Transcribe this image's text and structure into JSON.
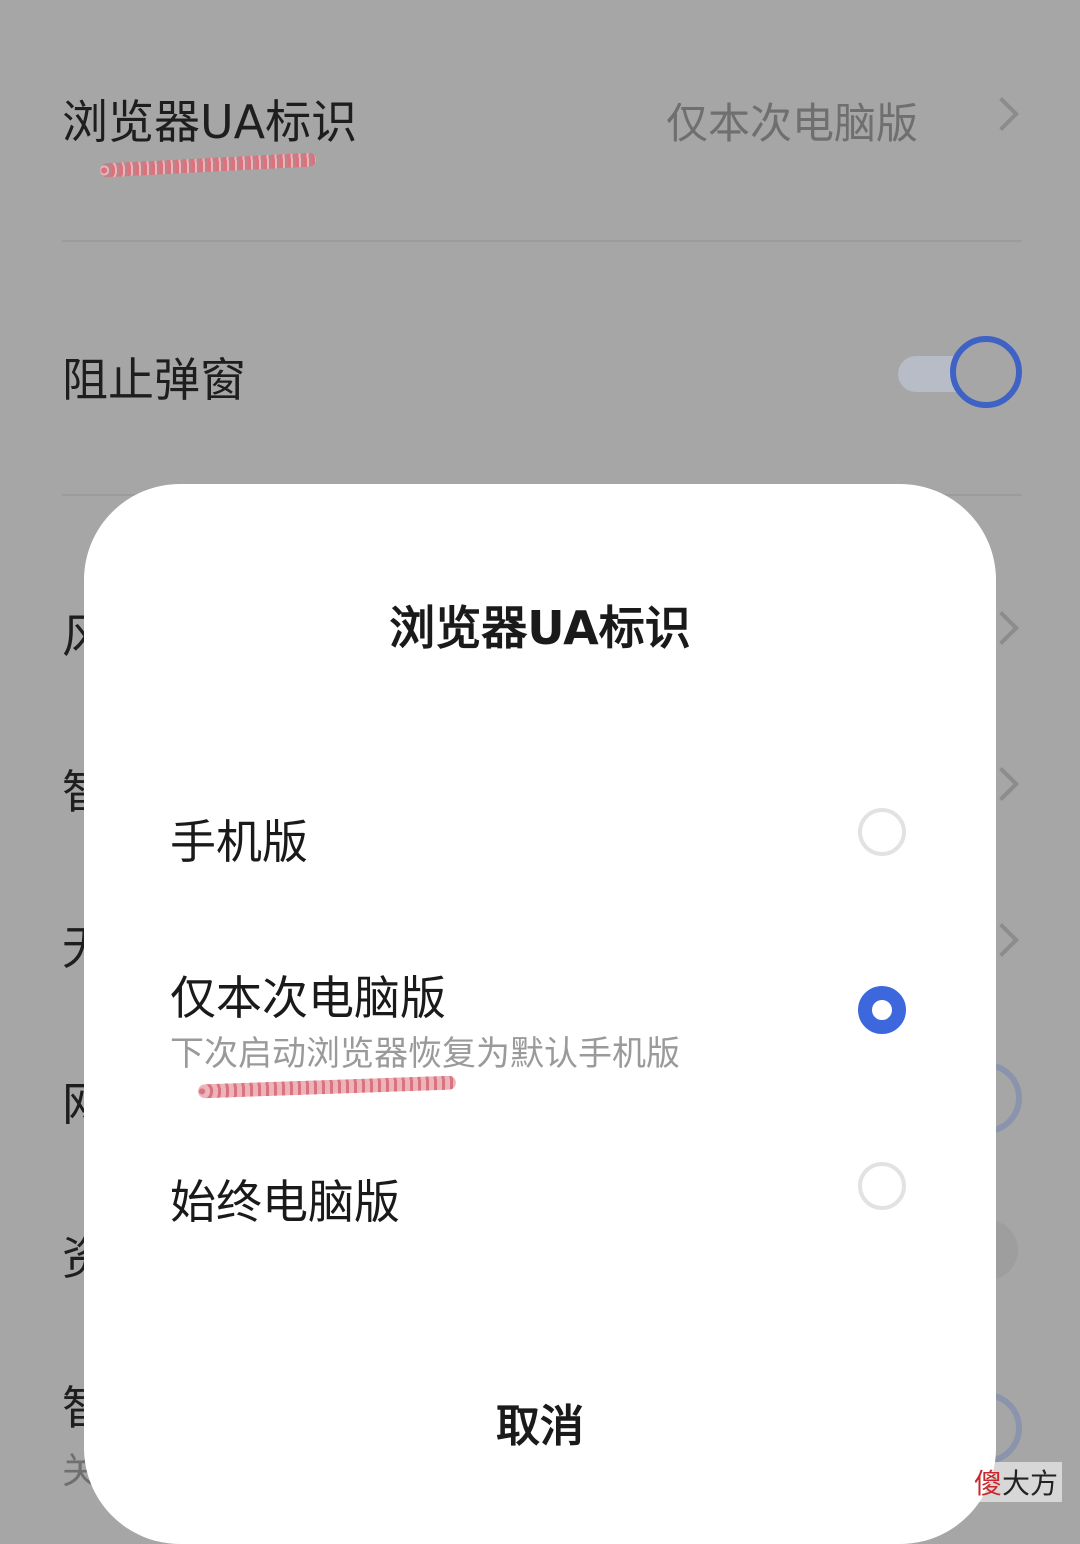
{
  "settings": {
    "ua_row": {
      "title": "浏览器UA标识",
      "value": "仅本次电脑版"
    },
    "popup_block_row": {
      "title": "阻止弹窗",
      "toggle_on": true
    },
    "partial_rows": [
      {
        "title_visible": "风"
      },
      {
        "title_visible": "智"
      },
      {
        "title_visible": "无"
      },
      {
        "title_visible": "网"
      },
      {
        "title_visible": "资"
      },
      {
        "title_visible": "智",
        "subtitle_visible": "关"
      }
    ]
  },
  "dialog": {
    "title": "浏览器UA标识",
    "options": [
      {
        "label": "手机版",
        "sublabel": "",
        "selected": false
      },
      {
        "label": "仅本次电脑版",
        "sublabel": "下次启动浏览器恢复为默认手机版",
        "selected": true
      },
      {
        "label": "始终电脑版",
        "sublabel": "",
        "selected": false
      }
    ],
    "cancel_label": "取消"
  },
  "watermark": {
    "first_char": "傻",
    "rest": "大方"
  },
  "colors": {
    "accent": "#3d67dd",
    "overlay_bg": "#a6a6a6",
    "scribble": "#d65c68"
  }
}
